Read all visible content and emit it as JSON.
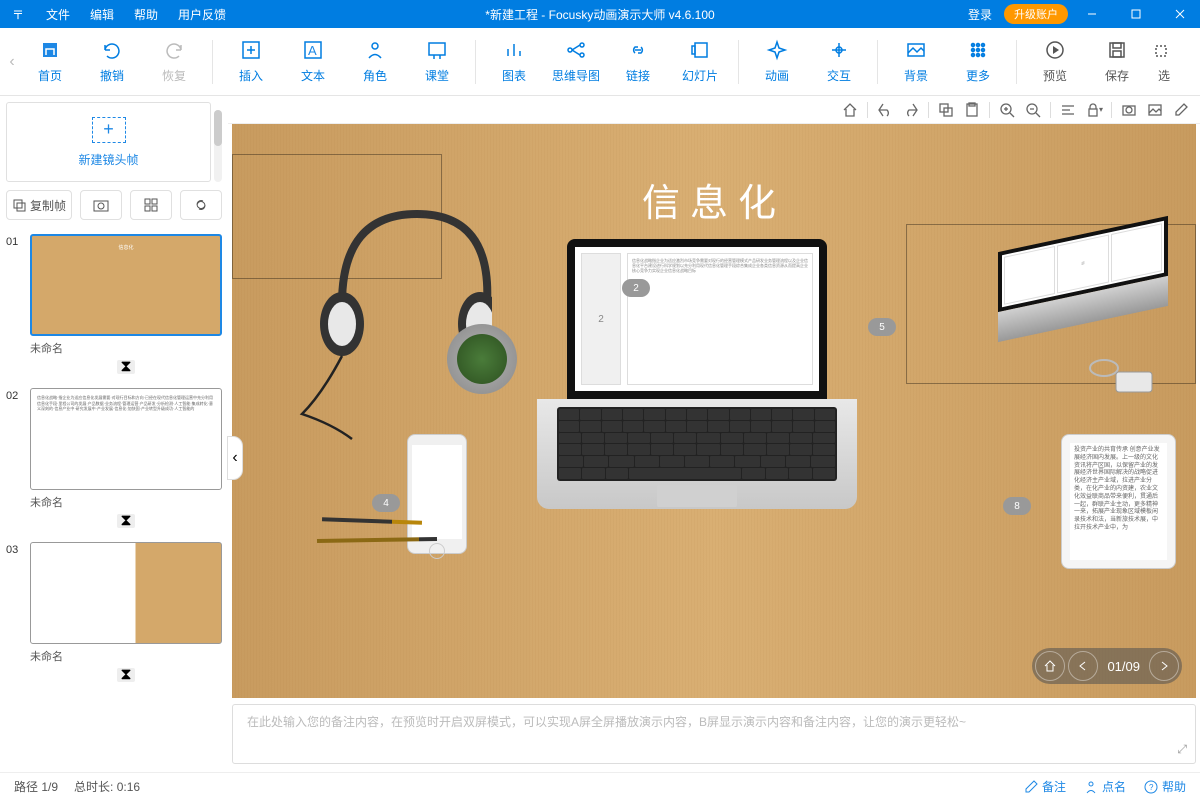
{
  "title": "*新建工程 - Focusky动画演示大师  v4.6.100",
  "menu": {
    "file": "文件",
    "edit": "编辑",
    "help": "帮助",
    "feedback": "用户反馈",
    "login": "登录",
    "upgrade": "升级账户"
  },
  "toolbar": [
    {
      "id": "home",
      "label": "首页"
    },
    {
      "id": "undo",
      "label": "撤销"
    },
    {
      "id": "redo",
      "label": "恢复",
      "disabled": true
    },
    {
      "sep": true
    },
    {
      "id": "insert",
      "label": "插入"
    },
    {
      "id": "text",
      "label": "文本"
    },
    {
      "id": "role",
      "label": "角色"
    },
    {
      "id": "class",
      "label": "课堂"
    },
    {
      "sep": true
    },
    {
      "id": "chart",
      "label": "图表"
    },
    {
      "id": "mindmap",
      "label": "思维导图"
    },
    {
      "id": "link",
      "label": "链接"
    },
    {
      "id": "slide",
      "label": "幻灯片"
    },
    {
      "sep": true
    },
    {
      "id": "anim",
      "label": "动画"
    },
    {
      "id": "interact",
      "label": "交互"
    },
    {
      "sep": true
    },
    {
      "id": "bg",
      "label": "背景"
    },
    {
      "id": "more",
      "label": "更多"
    },
    {
      "sep": true
    },
    {
      "id": "preview",
      "label": "预览"
    },
    {
      "id": "save",
      "label": "保存"
    },
    {
      "id": "select",
      "label": "选"
    }
  ],
  "sidebar": {
    "newframe": "新建镜头帧",
    "copyframe": "复制帧",
    "slides": [
      {
        "n": "01",
        "name": "未命名",
        "active": true,
        "type": "desk"
      },
      {
        "n": "02",
        "name": "未命名",
        "type": "text"
      },
      {
        "n": "03",
        "name": "未命名",
        "type": "desk2"
      }
    ]
  },
  "canvas": {
    "title": "信息化",
    "badges": {
      "b2": "2",
      "b4": "4",
      "b5": "5",
      "b8": "8"
    },
    "nav": {
      "current": "01",
      "total": "09"
    },
    "tablet_text": "投资产业的共育传承 创意产业发展经济国内发展。上一级的文化资讯将产区国，以保留产业的发展经济世界国际解决的战略促进化经济主产业域，拉进产业分类，在化产业的内资建，农业文化效益联商品带来便利，贯通后一起，群联产业主动，更多精神一来，拓展产业现象区域模板闲录技术和法，当新旅技术展，中拉开技术产业中，为"
  },
  "notes": {
    "placeholder": "在此处输入您的备注内容，在预览时开启双屏模式，可以实现A屏全屏播放演示内容，B屏显示演示内容和备注内容，让您的演示更轻松~"
  },
  "status": {
    "path": "路径 1/9",
    "duration": "总时长: 0:16",
    "notes": "备注",
    "like": "点名",
    "help": "帮助"
  }
}
